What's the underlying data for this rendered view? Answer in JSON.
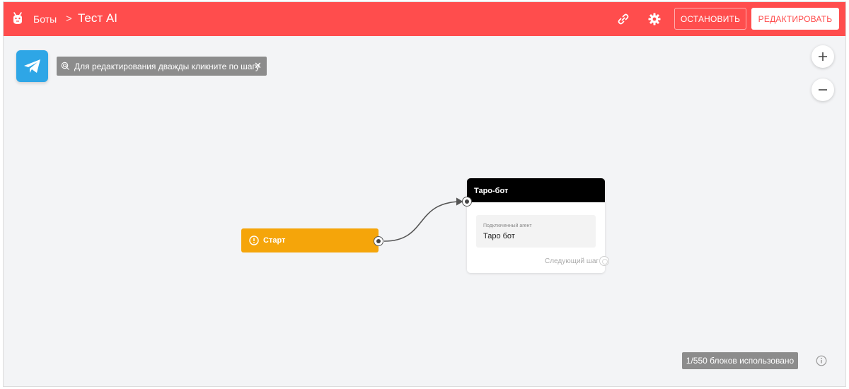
{
  "header": {
    "breadcrumb_root": "Боты",
    "breadcrumb_separator": ">",
    "bot_title": "Тест AI",
    "stop_label": "ОСТАНОВИТЬ",
    "edit_label": "РЕДАКТИРОВАТЬ",
    "icons": [
      "bot-logo-icon",
      "link-icon",
      "gear-icon"
    ]
  },
  "canvas": {
    "channel_icon": "telegram-icon",
    "hint_text": "Для редактирования дважды кликните по шагу",
    "hint_close": "✕",
    "zoom_in": "+",
    "zoom_out": "−",
    "start_node": {
      "label": "Старт",
      "icon": "alert-circle-icon"
    },
    "step_node": {
      "title": "Таро-бот",
      "agent_label": "Подключенный агент",
      "agent_value": "Таро бот",
      "next_step_label": "Следующий шаг"
    },
    "usage_text": "1/550 блоков использовано"
  },
  "colors": {
    "accent": "#ff4d4d",
    "start": "#f5a50a",
    "telegram": "#2ea6e6",
    "step_header": "#000000"
  }
}
